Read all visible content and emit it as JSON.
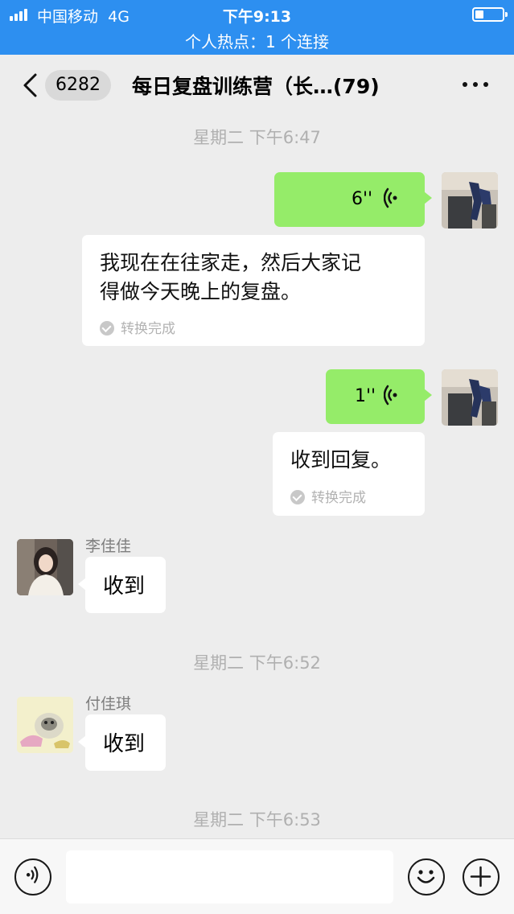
{
  "status_bar": {
    "carrier": "中国移动",
    "network": "4G",
    "time": "下午9:13",
    "battery_level": 0.3,
    "hotspot": "个人热点：1 个连接",
    "background_color": "#2d8ff0"
  },
  "nav": {
    "back_count": "6282",
    "title": "每日复盘训练营（长…(79)",
    "icons": [
      "chevron-left-icon",
      "more-icon"
    ]
  },
  "chat": {
    "timestamps": [
      "星期二 下午6:47",
      "星期二 下午6:52",
      "星期二 下午6:53"
    ],
    "messages": [
      {
        "from": "self",
        "type": "voice",
        "duration": "6''",
        "transcription_lines": [
          "我现在在往家走，然后大家记",
          "得做今天晚上的复盘。"
        ],
        "transcription_status": "转换完成"
      },
      {
        "from": "self",
        "type": "voice",
        "duration": "1''",
        "transcription_lines": [
          "收到回复。"
        ],
        "transcription_status": "转换完成"
      },
      {
        "from": "other",
        "sender": "李佳佳",
        "type": "text",
        "text": "收到"
      },
      {
        "from": "other",
        "sender": "付佳琪",
        "type": "text",
        "text": "收到"
      }
    ],
    "bubble_colors": {
      "self": "#95ec69",
      "other": "#ffffff"
    }
  },
  "input_bar": {
    "text_value": "",
    "icons": [
      "voice-input-icon",
      "emoji-icon",
      "plus-icon"
    ]
  }
}
